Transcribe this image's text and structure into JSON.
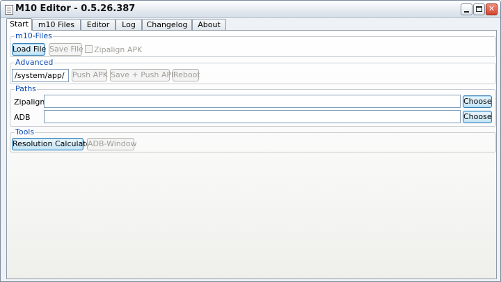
{
  "window": {
    "title": "M10 Editor - 0.5.26.387",
    "app_icon": "document-icon",
    "controls": {
      "minimize": "minimize-icon",
      "maximize": "maximize-icon",
      "close": "close-icon",
      "close_glyph": "✕"
    }
  },
  "tabs": [
    {
      "label": "Start",
      "active": true
    },
    {
      "label": "m10 Files",
      "active": false
    },
    {
      "label": "Editor",
      "active": false
    },
    {
      "label": "Log",
      "active": false
    },
    {
      "label": "Changelog",
      "active": false
    },
    {
      "label": "About",
      "active": false
    }
  ],
  "m10_files": {
    "title": "m10-Files",
    "load_file": "Load File",
    "save_file": "Save File",
    "zipalign_apk": "Zipalign APK",
    "zipalign_checked": false
  },
  "advanced": {
    "title": "Advanced",
    "path_value": "/system/app/",
    "push_apk": "Push APK",
    "save_push_apk": "Save + Push APK",
    "reboot": "Reboot"
  },
  "paths": {
    "title": "Paths",
    "zipalign_label": "Zipalign",
    "zipalign_value": "",
    "zipalign_choose": "Choose",
    "adb_label": "ADB",
    "adb_value": "",
    "adb_choose": "Choose"
  },
  "tools": {
    "title": "Tools",
    "resolution_calculator": "Resolution Calculator",
    "adb_window": "ADB-Window"
  },
  "colors": {
    "group_title": "#0a48b4",
    "close_button": "#d4442d",
    "disabled_text": "#a09e99"
  }
}
